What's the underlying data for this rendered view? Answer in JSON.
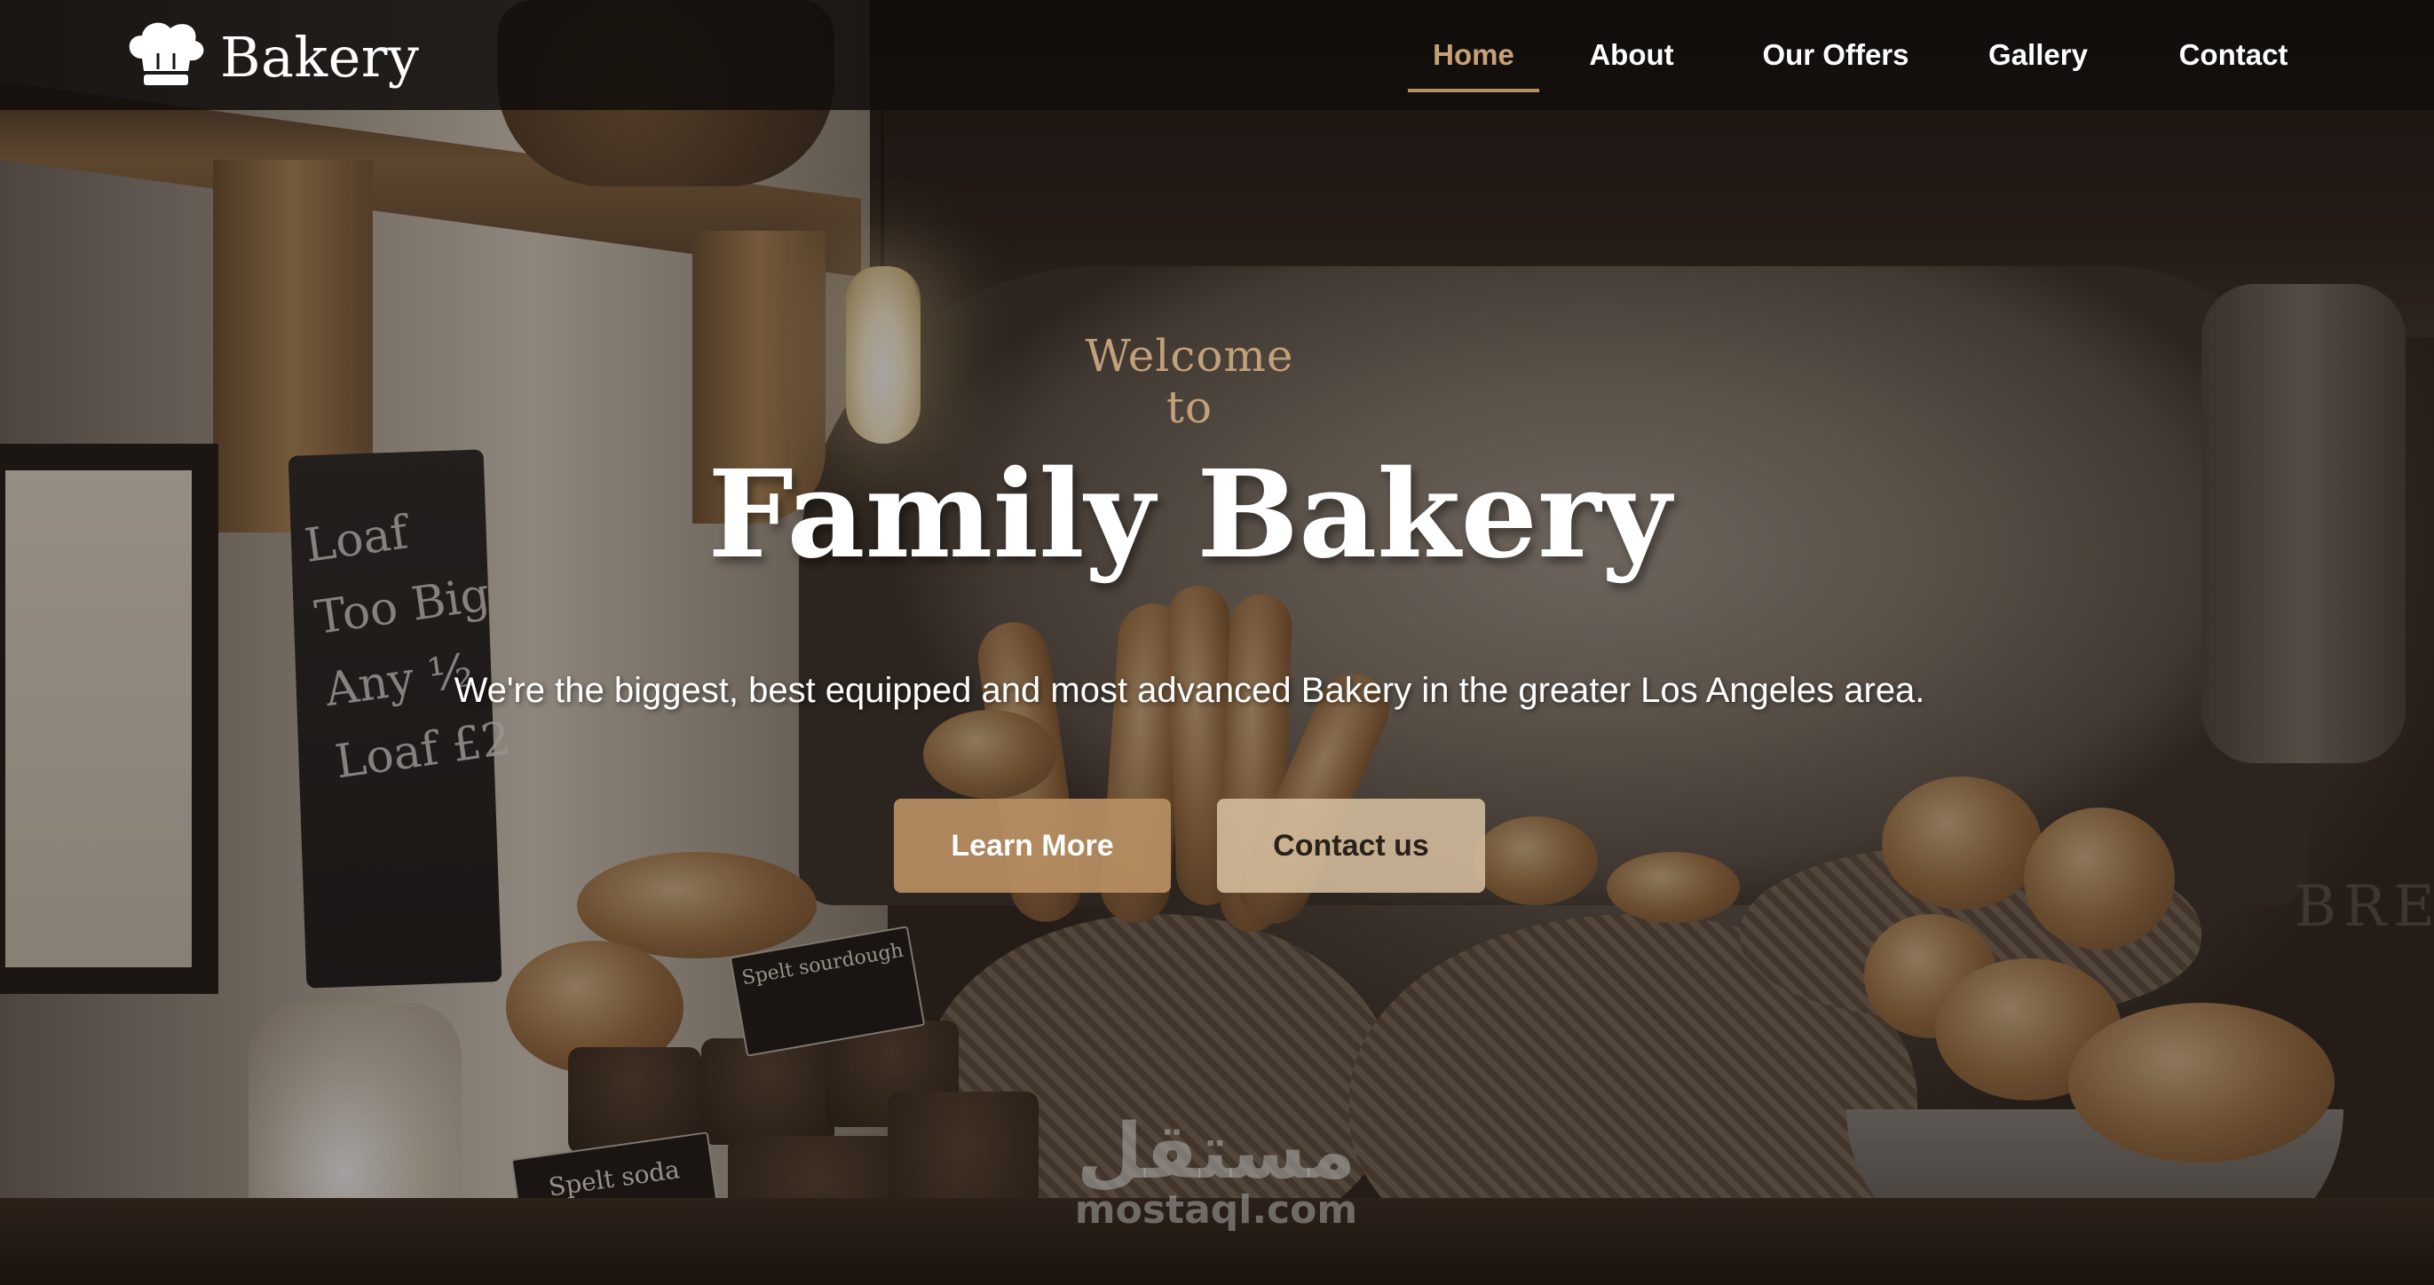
{
  "brand": {
    "name": "Bakery",
    "logo_icon": "chef-hat-icon"
  },
  "nav": {
    "items": [
      {
        "label": "Home",
        "active": true
      },
      {
        "label": "About",
        "active": false
      },
      {
        "label": "Our Offers",
        "active": false
      },
      {
        "label": "Gallery",
        "active": false
      },
      {
        "label": "Contact",
        "active": false
      }
    ]
  },
  "hero": {
    "welcome": "Welcome to",
    "title": "Family Bakery",
    "tagline": "We're the biggest, best equipped and most advanced Bakery in the greater Los Angeles area.",
    "primary_button": "Learn More",
    "secondary_button": "Contact us"
  },
  "photo_labels": {
    "chalkboard": "Loaf Too Big Any ½ Loaf £2",
    "card_1": "Spelt sourdough",
    "card_2": "Spelt soda",
    "crate": "BRE"
  },
  "watermark": {
    "arabic": "مستقل",
    "latin": "mostaql.com"
  },
  "colors": {
    "accent": "#b88f63",
    "accent_light": "#d6be9e",
    "nav_background": "#120e0c",
    "welcome_text": "#c2a07a"
  }
}
